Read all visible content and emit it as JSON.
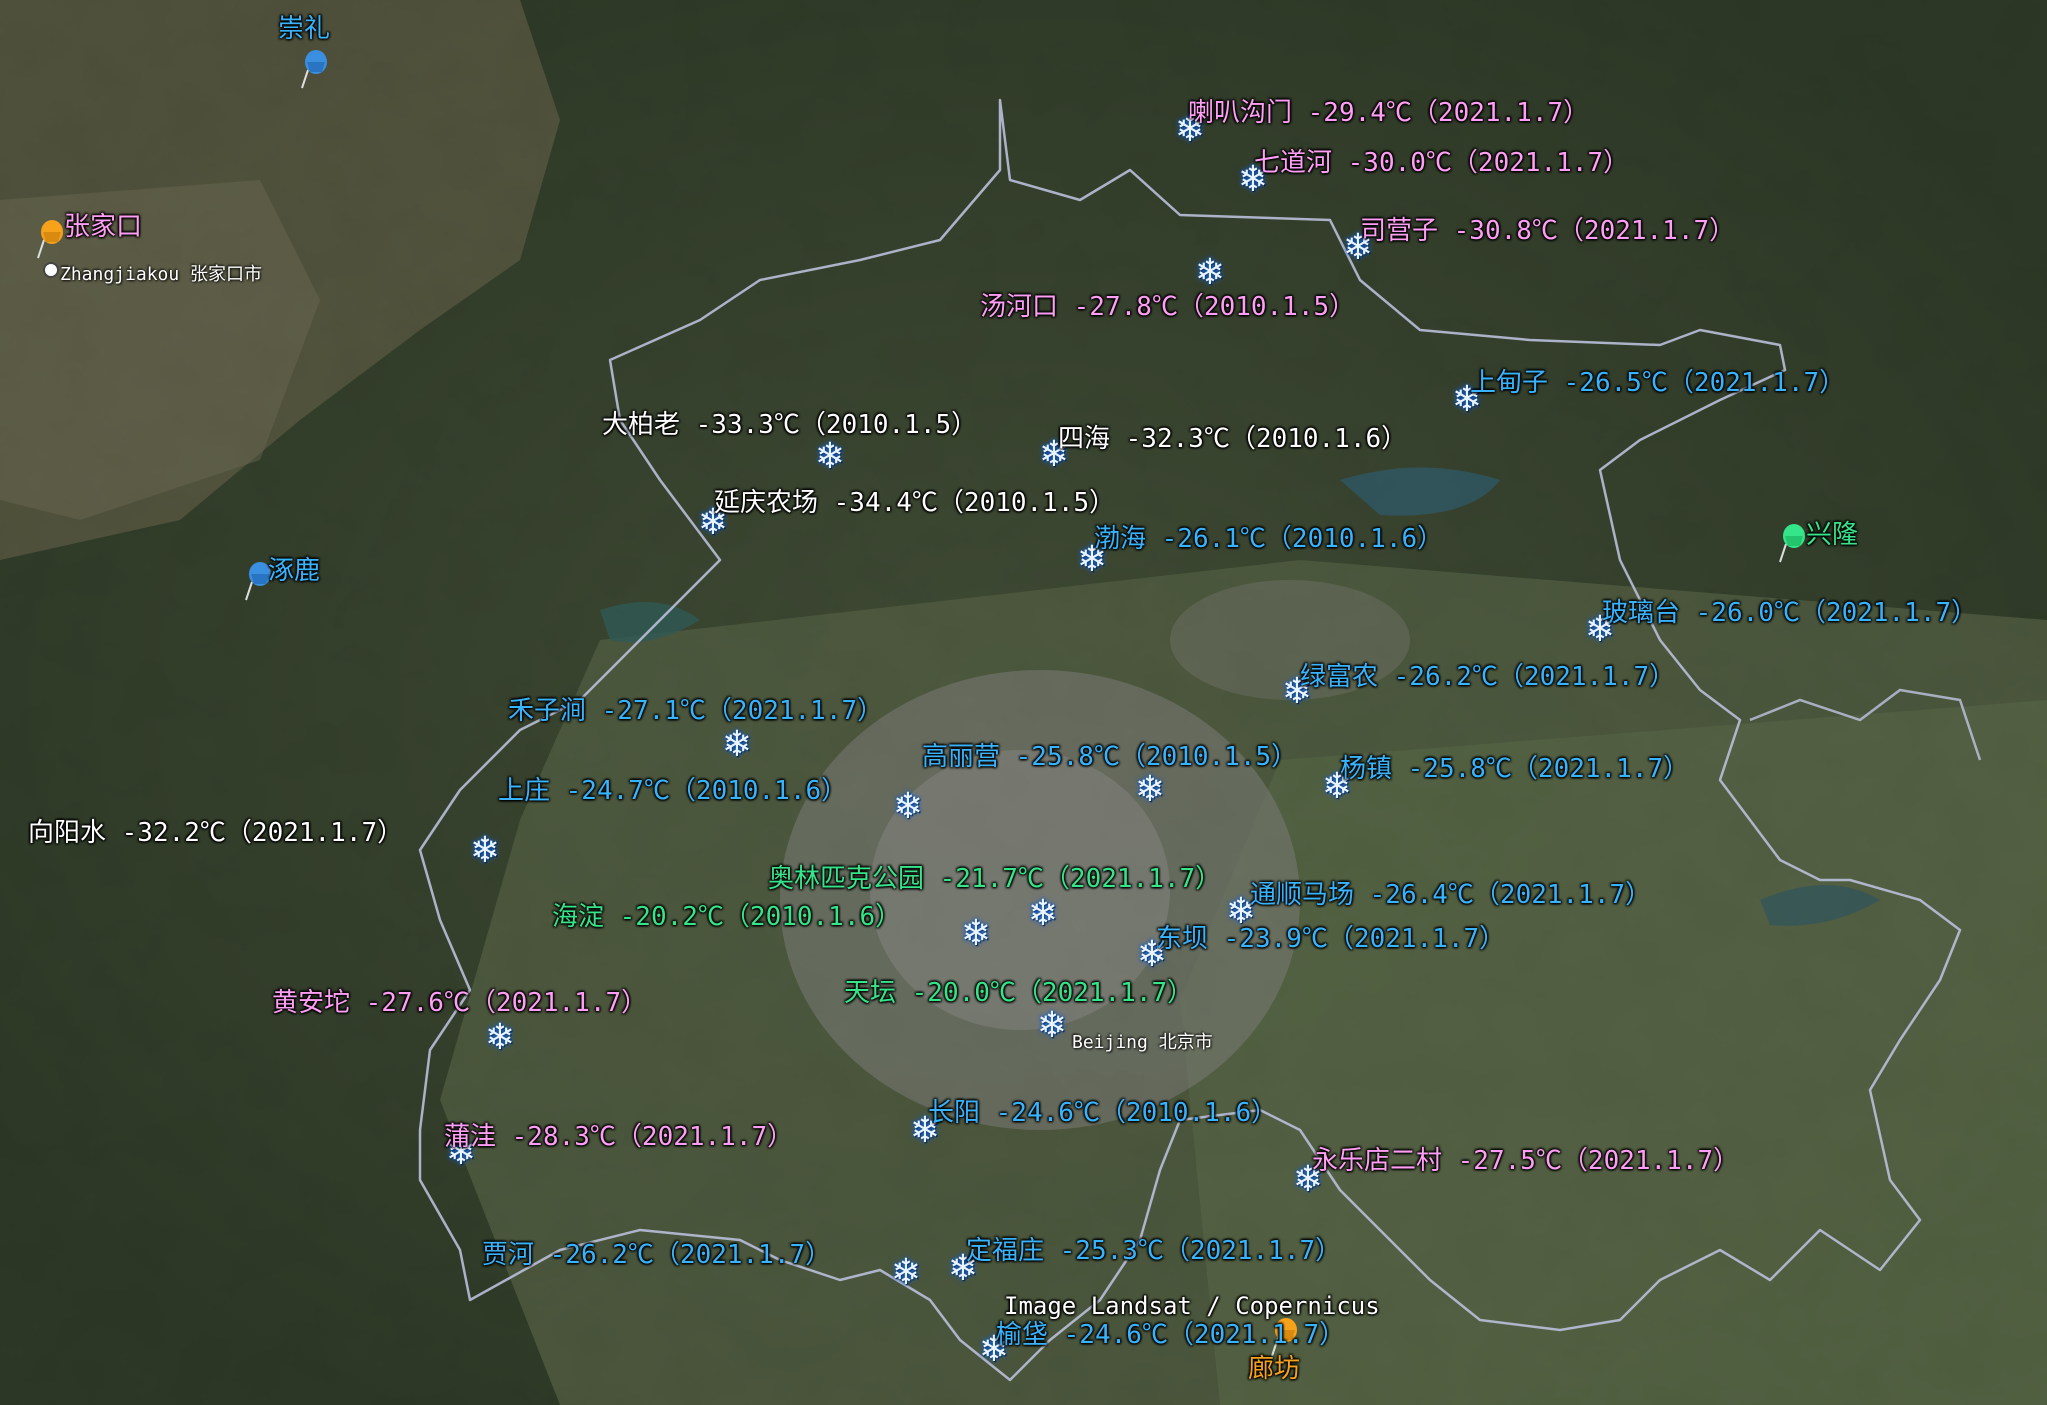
{
  "colors": {
    "pink": "#ff9ef4",
    "blue": "#38b4ff",
    "white": "#ffffff",
    "green": "#35e58a",
    "orange": "#f6a21a",
    "boundary": "#b9bfd9"
  },
  "places": {
    "chongli": "崇礼",
    "zhangjiakou": "张家口",
    "zhangjiakou_city": "Zhangjiakou 张家口市",
    "zhuolu": "涿鹿",
    "xinglong": "兴隆",
    "beijing_city": "Beijing 北京市",
    "langfang": "廊坊"
  },
  "stations": [
    {
      "label": "喇叭沟门 -29.4℃（2021.1.7）",
      "color": "pink"
    },
    {
      "label": "七道河 -30.0℃（2021.1.7）",
      "color": "pink"
    },
    {
      "label": "司营子 -30.8℃（2021.1.7）",
      "color": "pink"
    },
    {
      "label": "汤河口 -27.8℃（2010.1.5）",
      "color": "pink"
    },
    {
      "label": "上甸子 -26.5℃（2021.1.7）",
      "color": "blue"
    },
    {
      "label": "大柏老 -33.3℃（2010.1.5）",
      "color": "white"
    },
    {
      "label": "四海 -32.3℃（2010.1.6）",
      "color": "white"
    },
    {
      "label": "延庆农场 -34.4℃（2010.1.5）",
      "color": "white"
    },
    {
      "label": "渤海 -26.1℃（2010.1.6）",
      "color": "blue"
    },
    {
      "label": "玻璃台 -26.0℃（2021.1.7）",
      "color": "blue"
    },
    {
      "label": "绿富农 -26.2℃（2021.1.7）",
      "color": "blue"
    },
    {
      "label": "禾子涧 -27.1℃（2021.1.7）",
      "color": "blue"
    },
    {
      "label": "高丽营 -25.8℃（2010.1.5）",
      "color": "blue"
    },
    {
      "label": "杨镇 -25.8℃（2021.1.7）",
      "color": "blue"
    },
    {
      "label": "上庄 -24.7℃（2010.1.6）",
      "color": "blue"
    },
    {
      "label": "向阳水 -32.2℃（2021.1.7）",
      "color": "white"
    },
    {
      "label": "奥林匹克公园 -21.7℃（2021.1.7）",
      "color": "green"
    },
    {
      "label": "通顺马场 -26.4℃（2021.1.7）",
      "color": "blue"
    },
    {
      "label": "海淀 -20.2℃（2010.1.6）",
      "color": "green"
    },
    {
      "label": "东坝 -23.9℃（2021.1.7）",
      "color": "blue"
    },
    {
      "label": "黄安坨 -27.6℃（2021.1.7）",
      "color": "pink"
    },
    {
      "label": "天坛 -20.0℃（2021.1.7）",
      "color": "green"
    },
    {
      "label": "长阳 -24.6℃（2010.1.6）",
      "color": "blue"
    },
    {
      "label": "蒲洼 -28.3℃（2021.1.7）",
      "color": "pink"
    },
    {
      "label": "永乐店二村 -27.5℃（2021.1.7）",
      "color": "pink"
    },
    {
      "label": "贾河 -26.2℃（2021.1.7）",
      "color": "blue"
    },
    {
      "label": "定福庄 -25.3℃（2021.1.7）",
      "color": "blue"
    },
    {
      "label": "榆垡 -24.6℃（2021.1.7）",
      "color": "blue"
    }
  ],
  "extra_snowflakes": 0,
  "attribution": "Image Landsat / Copernicus",
  "icons": {
    "snowflake": "❄",
    "pushpin": "pushpin-icon"
  }
}
